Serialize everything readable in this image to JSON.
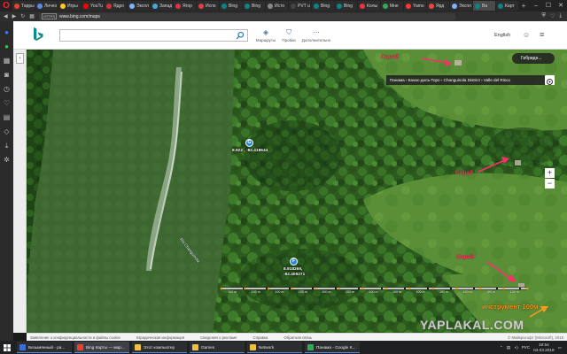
{
  "browser": {
    "tabs": [
      {
        "title": "Тарры",
        "color": "#e8412c"
      },
      {
        "title": "Лично",
        "color": "#5f89e6"
      },
      {
        "title": "Игры",
        "color": "#ffcc22"
      },
      {
        "title": "YouTu",
        "color": "#ff0000"
      },
      {
        "title": "Ядро",
        "color": "#d83333"
      },
      {
        "title": "Экспл",
        "color": "#7fb2ff"
      },
      {
        "title": "Запад",
        "color": "#44aadd"
      },
      {
        "title": "Ягор",
        "color": "#dd3344"
      },
      {
        "title": "Испо",
        "color": "#e04040"
      },
      {
        "title": "Bing",
        "color": "#0b8484"
      },
      {
        "title": "Bing",
        "color": "#0b8484"
      },
      {
        "title": "Исто",
        "color": "#888888"
      },
      {
        "title": "PVT u",
        "color": "#444444"
      },
      {
        "title": "Bing",
        "color": "#0b8484"
      },
      {
        "title": "Bing",
        "color": "#0b8484"
      },
      {
        "title": "Колы",
        "color": "#ee3344"
      },
      {
        "title": "Мне",
        "color": "#33aa55"
      },
      {
        "title": "Yamo",
        "color": "#ff3333"
      },
      {
        "title": "Ярд",
        "color": "#ee4444"
      },
      {
        "title": "Экспл",
        "color": "#7fb2ff"
      },
      {
        "title": "Ва",
        "color": "#0b8484"
      },
      {
        "title": "Карт",
        "color": "#0b8484"
      }
    ],
    "url": "www.bing.com/maps",
    "url_badge": "HTTPS"
  },
  "bing": {
    "tools": [
      {
        "label": "Маршруты",
        "glyph": "◈"
      },
      {
        "label": "Пробки",
        "glyph": "⛉"
      },
      {
        "label": "Дополнительно",
        "glyph": "⋯"
      }
    ],
    "language": "English"
  },
  "map": {
    "hybrid_label": "Гибридн...",
    "breadcrumb": "Панама › Бокас-дель-Торо › Changuinola District › Valle del Risco",
    "pins": [
      {
        "letter": "G",
        "coord": "8.922 , -82.418644"
      },
      {
        "letter": "F",
        "coord_lat": "8.918269,",
        "coord_lon": "-82.409271"
      }
    ],
    "river_label": "Rio Changuinola",
    "annotations": [
      "Сарай",
      "Сарай",
      "Сарай"
    ],
    "tool_annotation": "инструмент 100м",
    "measure_labels": [
      "100 m",
      "100 m",
      "100 m",
      "100 m",
      "100 m",
      "100 m",
      "100 m",
      "100 m",
      "100 m",
      "100 m",
      "100 m",
      "100 m",
      "100 m"
    ],
    "watermark": "YAPLAKAL.COM"
  },
  "footer": {
    "links": [
      "Заявление о конфиденциальности и файлы cookie",
      "Юридическая информация",
      "Сведения о рекламе",
      "Справка",
      "Обратная связь"
    ],
    "copyright": "© Майкрософт (Microsoft), 2018"
  },
  "taskbar": {
    "items": [
      {
        "title": "Безымянный - pa...",
        "color": "#3b6fd4"
      },
      {
        "title": "Bing Карты — мар...",
        "color": "#e8412c"
      },
      {
        "title": "Этот компьютер",
        "color": "#f0c040"
      },
      {
        "title": "Games",
        "color": "#f0c040"
      },
      {
        "title": "Network",
        "color": "#f0c040"
      },
      {
        "title": "Панама - Google K...",
        "color": "#34a853"
      }
    ],
    "lang": "РУС",
    "time": "19:54",
    "date": "04.03.2018"
  }
}
